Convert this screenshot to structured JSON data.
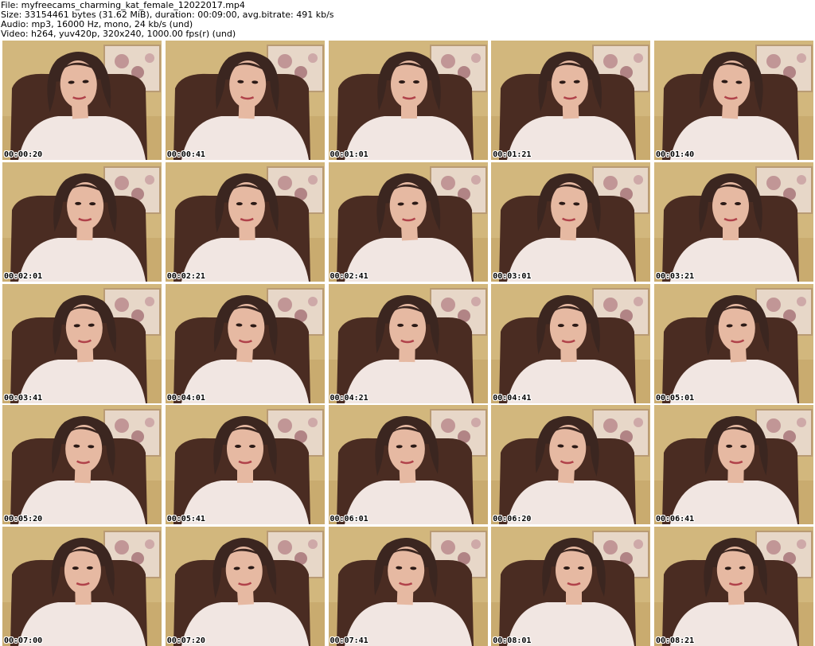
{
  "header": {
    "file": "File: myfreecams_charming_kat_female_12022017.mp4",
    "size": "Size: 33154461 bytes (31.62 MiB), duration: 00:09:00, avg.bitrate: 491 kb/s",
    "audio": "Audio: mp3, 16000 Hz, mono, 24 kb/s (und)",
    "video": "Video: h264, yuv420p, 320x240, 1000.00 fps(r) (und)"
  },
  "thumbnails": [
    {
      "timestamp": "00:00:20"
    },
    {
      "timestamp": "00:00:41"
    },
    {
      "timestamp": "00:01:01"
    },
    {
      "timestamp": "00:01:21"
    },
    {
      "timestamp": "00:01:40"
    },
    {
      "timestamp": "00:02:01"
    },
    {
      "timestamp": "00:02:21"
    },
    {
      "timestamp": "00:02:41"
    },
    {
      "timestamp": "00:03:01"
    },
    {
      "timestamp": "00:03:21"
    },
    {
      "timestamp": "00:03:41"
    },
    {
      "timestamp": "00:04:01"
    },
    {
      "timestamp": "00:04:21"
    },
    {
      "timestamp": "00:04:41"
    },
    {
      "timestamp": "00:05:01"
    },
    {
      "timestamp": "00:05:20"
    },
    {
      "timestamp": "00:05:41"
    },
    {
      "timestamp": "00:06:01"
    },
    {
      "timestamp": "00:06:20"
    },
    {
      "timestamp": "00:06:41"
    },
    {
      "timestamp": "00:07:00"
    },
    {
      "timestamp": "00:07:20"
    },
    {
      "timestamp": "00:07:41"
    },
    {
      "timestamp": "00:08:01"
    },
    {
      "timestamp": "00:08:21"
    }
  ],
  "colors": {
    "wall": "#d2b77d",
    "chair": "#4a2c22",
    "shirt": "#f1e6e2",
    "hair": "#3b2620",
    "skin": "#e6b9a2",
    "painting": "#e7d7c8"
  }
}
